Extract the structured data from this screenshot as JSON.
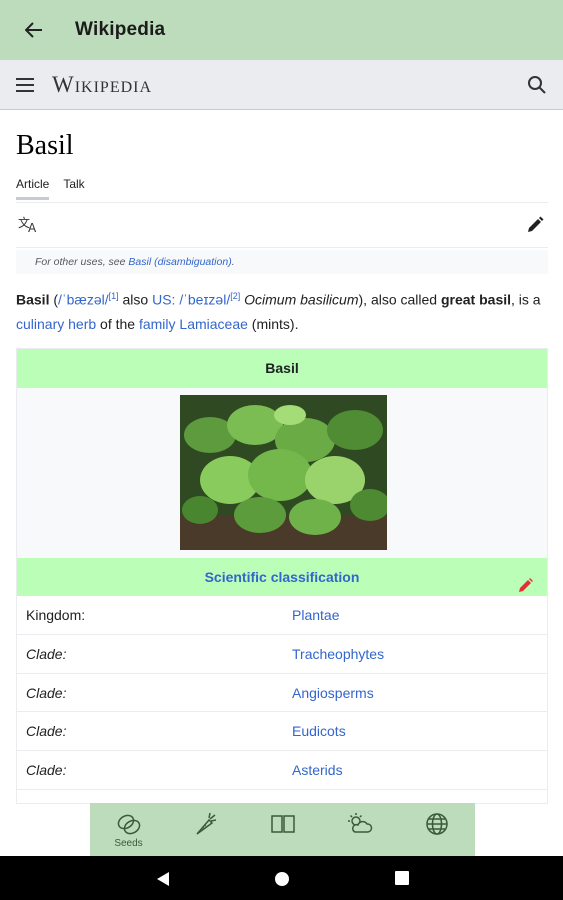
{
  "appbar": {
    "title": "Wikipedia",
    "back_icon": "arrow-left-icon"
  },
  "wiki_header": {
    "wordmark": "Wikipedia",
    "menu_icon": "hamburger-icon",
    "search_icon": "search-icon"
  },
  "article": {
    "title": "Basil",
    "tabs": [
      {
        "label": "Article"
      },
      {
        "label": "Talk"
      }
    ],
    "hatnote_prefix": "For other uses, see ",
    "hatnote_link": "Basil (disambiguation)",
    "hatnote_suffix": ".",
    "lead": {
      "term": "Basil",
      "ipa_uk": "/ˈbæzəl/",
      "ref1": "[1]",
      "also": " also ",
      "us_label": "US:",
      "ipa_us": "/ˈbeɪzəl/",
      "ref2": "[2]",
      "binomial": "Ocimum basilicum",
      "also_called": "), also called ",
      "alt_name": "great basil",
      "is_a": ", is a ",
      "link_herb": "culinary herb",
      "of_the": " of the ",
      "link_family": "family",
      "link_lamiaceae": "Lamiaceae",
      "mints": " (mints)."
    }
  },
  "infobox": {
    "title": "Basil",
    "classification_header": "Scientific classification",
    "rows": [
      {
        "key": "Kingdom:",
        "value": "Plantae"
      },
      {
        "key": "Clade:",
        "value": "Tracheophytes"
      },
      {
        "key": "Clade:",
        "value": "Angiosperms"
      },
      {
        "key": "Clade:",
        "value": "Eudicots"
      },
      {
        "key": "Clade:",
        "value": "Asterids"
      }
    ]
  },
  "bottom_nav": {
    "items": [
      {
        "label": "Seeds",
        "icon": "seeds-icon"
      },
      {
        "label": "",
        "icon": "carrot-icon"
      },
      {
        "label": "",
        "icon": "book-icon"
      },
      {
        "label": "",
        "icon": "weather-icon"
      },
      {
        "label": "",
        "icon": "globe-icon"
      }
    ]
  },
  "colors": {
    "appbar": "#bcdcbc",
    "infobox_header": "#bbfeb8",
    "link": "#3366cc"
  }
}
